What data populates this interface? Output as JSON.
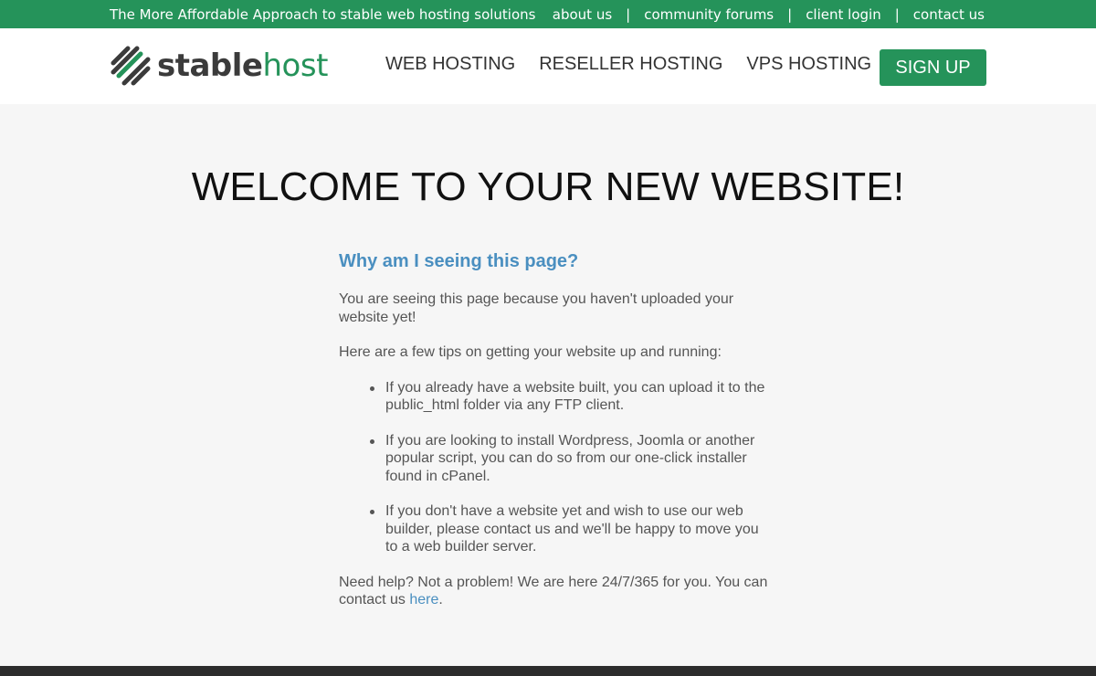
{
  "topbar": {
    "tagline": "The More Affordable Approach to stable web hosting solutions",
    "links": [
      "about us",
      "community forums",
      "client login",
      "contact us"
    ],
    "separator": "|"
  },
  "header": {
    "logo": {
      "icon": "stablehost-logo-icon",
      "text_stable": "stable",
      "text_host": "host"
    },
    "nav": [
      "WEB HOSTING",
      "RESELLER HOSTING",
      "VPS HOSTING"
    ],
    "signup_label": "SIGN UP"
  },
  "main": {
    "title": "WELCOME TO YOUR NEW WEBSITE!",
    "heading": "Why am I seeing this page?",
    "intro": "You are seeing this page because you haven't uploaded your website yet!",
    "tips_intro": "Here are a few tips on getting your website up and running:",
    "tips": [
      "If you already have a website built, you can upload it to the public_html folder via any FTP client.",
      "If you are looking to install Wordpress, Joomla or another popular script, you can do so from our one-click installer found in cPanel.",
      "If you don't have a website yet and wish to use our web builder, please contact us and we'll be happy to move you to a web builder server."
    ],
    "help_text": "Need help? Not a problem! We are here 24/7/365 for you. You can contact us ",
    "help_link": "here",
    "help_end": "."
  },
  "colors": {
    "brand_green": "#25935a",
    "link_blue": "#4a8fc0",
    "footer_dark": "#2c2c2c"
  }
}
